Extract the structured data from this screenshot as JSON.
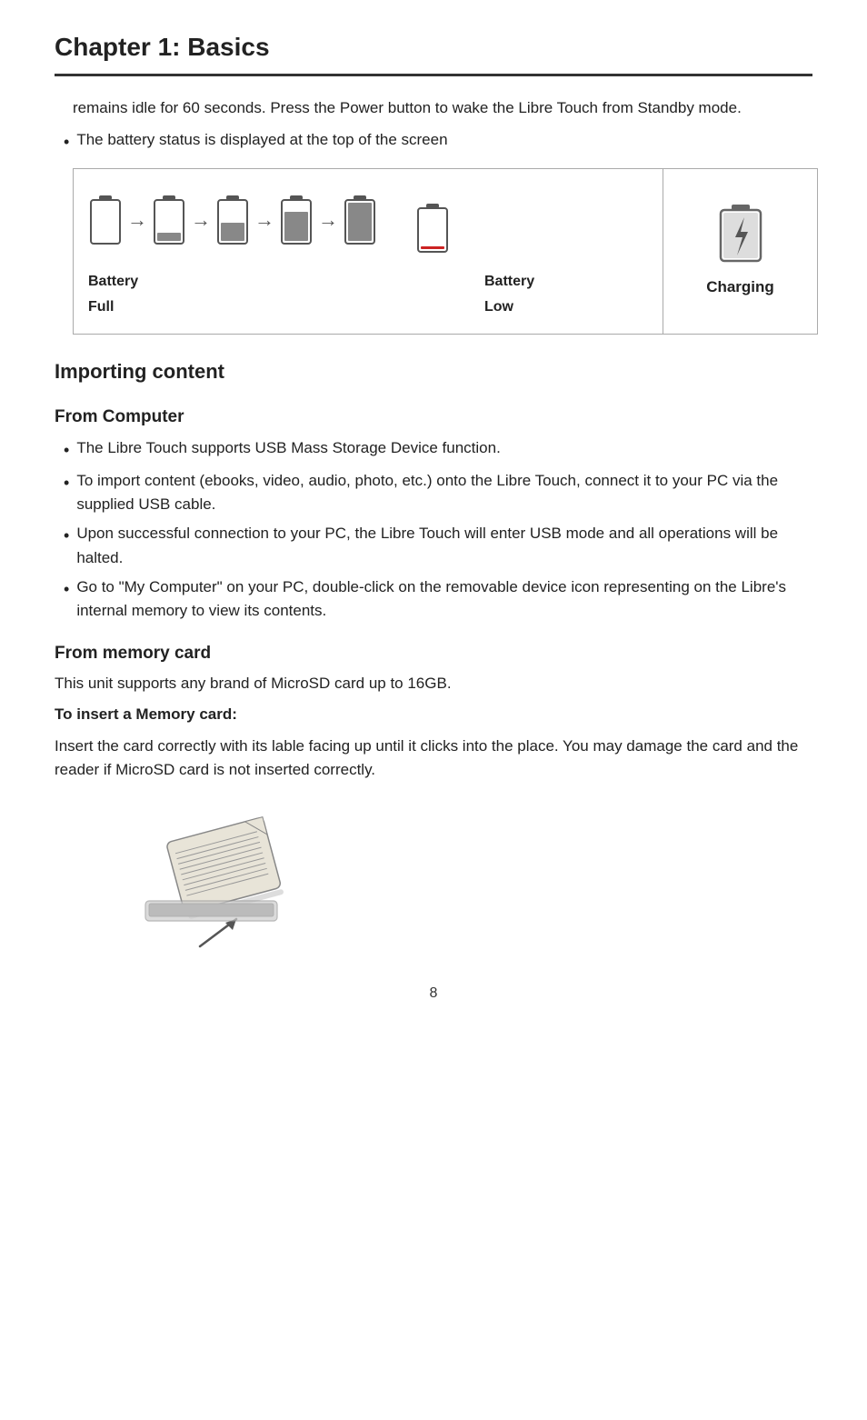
{
  "page": {
    "chapter_title": "Chapter 1: Basics",
    "page_number": "8",
    "intro_text": "remains idle for 60 seconds. Press the Power button to wake the Libre Touch from Standby mode.",
    "bullet_battery_status": "The battery status is displayed at the top of the screen",
    "battery_diagram": {
      "label_full": "Battery\nFull",
      "label_low": "Battery\nLow",
      "label_charging": "Charging"
    },
    "importing_heading": "Importing content",
    "from_computer_heading": "From Computer",
    "from_computer_bullets": [
      "The Libre Touch supports USB Mass Storage Device function.",
      "To import content (ebooks, video, audio, photo, etc.) onto the Libre Touch, connect it to your PC via the supplied USB cable.",
      "Upon successful connection to your PC, the Libre Touch will enter USB mode and all operations will be halted.",
      "Go to \"My Computer\" on your PC, double-click on the removable device icon representing on the Libre's internal memory to view its contents."
    ],
    "from_memory_heading": "From memory card",
    "from_memory_text": "This unit supports any brand of MicroSD card up to 16GB.",
    "insert_card_label": "To insert a Memory card:",
    "insert_card_text": "Insert the card correctly with its lable facing up until it clicks into the place. You may damage the card and the reader if MicroSD card is not inserted correctly."
  }
}
